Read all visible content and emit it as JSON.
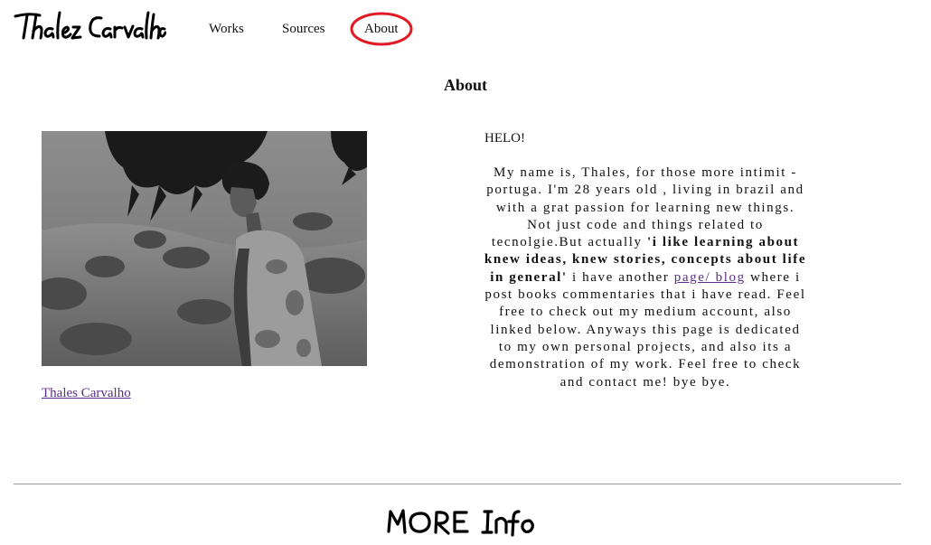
{
  "header": {
    "logo_text": "Thalez Carvalho",
    "nav": {
      "works": "Works",
      "sources": "Sources",
      "about": "About"
    }
  },
  "main": {
    "title": "About",
    "photo_caption": "Thales Carvalho",
    "greeting": "HELO!",
    "about": {
      "intro": "My name is, Thales, for those more intimit - portuga. I'm 28 years old , living in brazil and with a grat passion for learning new things. Not just code and things related to tecnolgie.But actually ",
      "bold": "'i like learning about knew ideas, knew stories, concepts about life in general'",
      "middle": " i have another ",
      "link": "page/ blog",
      "outro": " where i post books commentaries that i have read. Feel free to check out my medium account, also linked below. Anyways this page is dedicated to my own personal projects, and also its a demonstration of my work. Feel free to check and contact me! bye bye."
    }
  },
  "footer": {
    "more_info_text": "MORE Info"
  },
  "colors": {
    "link": "#5a2e8a",
    "highlight_ring": "#e01b24",
    "divider": "#9a9a9a"
  }
}
